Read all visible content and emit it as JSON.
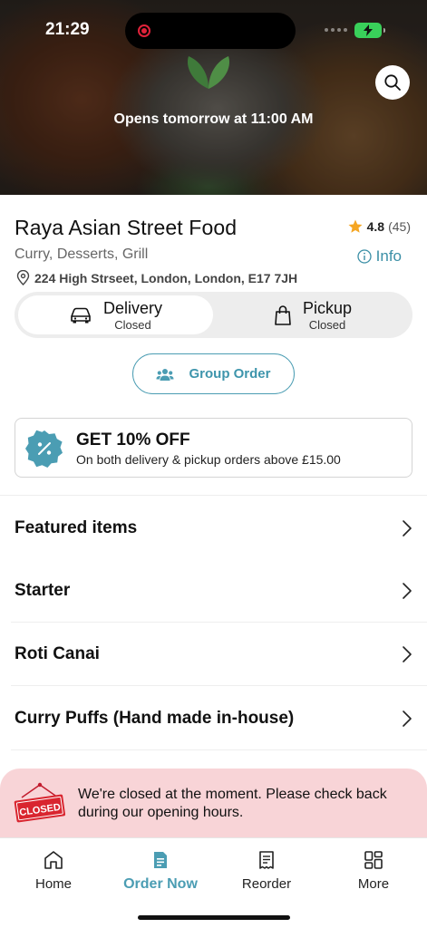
{
  "status_bar": {
    "time": "21:29"
  },
  "hero": {
    "opens_text": "Opens tomorrow at 11:00 AM"
  },
  "store": {
    "name": "Raya Asian Street Food",
    "rating": "4.8",
    "rating_count": "(45)",
    "categories": "Curry, Desserts, Grill",
    "info_label": "Info",
    "address": "224 High Strseet, London, London, E17 7JH"
  },
  "order_mode": {
    "delivery": {
      "label": "Delivery",
      "status": "Closed",
      "selected": true
    },
    "pickup": {
      "label": "Pickup",
      "status": "Closed",
      "selected": false
    }
  },
  "group_order": {
    "label": "Group Order"
  },
  "promo": {
    "title": "GET 10% OFF",
    "subtitle": "On both delivery & pickup orders above £15.00"
  },
  "menu": {
    "sections": [
      {
        "label": "Featured items"
      },
      {
        "label": "Starter"
      },
      {
        "label": "Roti Canai"
      },
      {
        "label": "Curry Puffs (Hand made in-house)"
      }
    ]
  },
  "closed_banner": {
    "sign_text": "CLOSED",
    "message": "We're closed at the moment. Please check back during our opening hours."
  },
  "tabs": [
    {
      "label": "Home",
      "icon": "home-icon",
      "active": false
    },
    {
      "label": "Order Now",
      "icon": "order-icon",
      "active": true
    },
    {
      "label": "Reorder",
      "icon": "receipt-icon",
      "active": false
    },
    {
      "label": "More",
      "icon": "grid-icon",
      "active": false
    }
  ],
  "colors": {
    "accent": "#4b9db3",
    "star": "#f5a623",
    "closed_red": "#e0223a",
    "banner_bg": "#f8d4d7"
  }
}
